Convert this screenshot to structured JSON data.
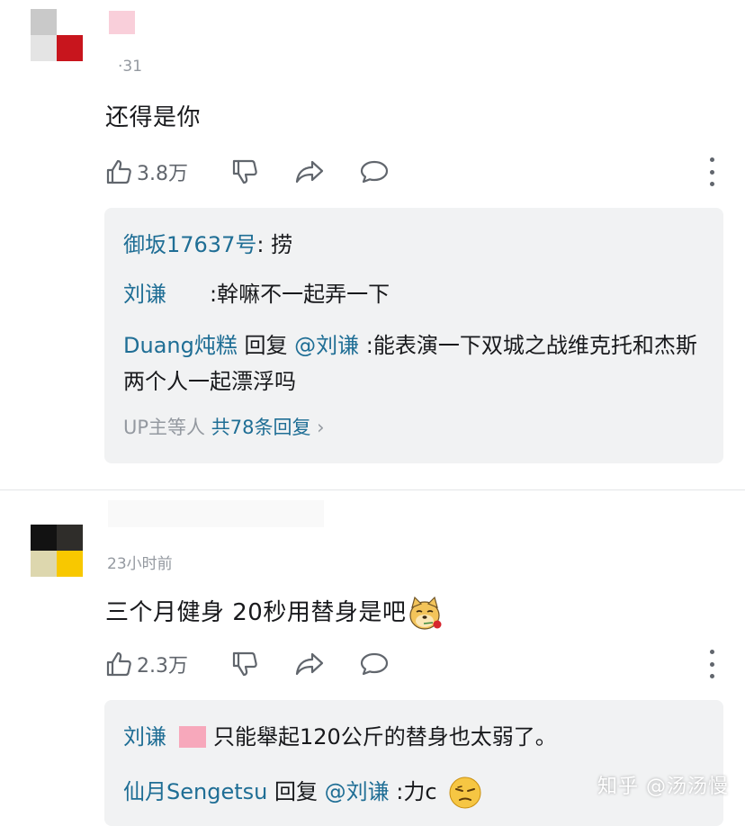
{
  "comments": [
    {
      "time": "·31",
      "content": "还得是你",
      "like_count": "3.8万",
      "replies": [
        {
          "user": "御坂17637号",
          "sep": ": ",
          "text": "捞"
        },
        {
          "user": "刘谦",
          "sep": ":",
          "text": "幹嘛不一起弄一下"
        },
        {
          "user": "Duang炖糕",
          "reply_word": " 回复 ",
          "at": "@刘谦",
          "sep": " :",
          "text": "能表演一下双城之战维克托和杰斯两个人一起漂浮吗"
        }
      ],
      "summary": {
        "prefix": "UP主等人 ",
        "total": "共78条回复",
        "chevron": "›"
      }
    },
    {
      "time": "23小时前",
      "content": "三个月健身 20秒用替身是吧",
      "like_count": "2.3万",
      "replies": [
        {
          "user": "刘谦",
          "sep": " ",
          "text": "只能舉起120公斤的替身也太弱了。"
        },
        {
          "user": "仙月Sengetsu",
          "reply_word": " 回复 ",
          "at": "@刘谦",
          "sep": " :",
          "text": "力c"
        }
      ]
    }
  ],
  "icons": {
    "like": "thumbs-up-icon",
    "dislike": "thumbs-down-icon",
    "share": "share-icon",
    "reply": "comment-icon",
    "more": "more-vertical-icon"
  },
  "colors": {
    "username": "#1f6e95",
    "muted": "#9499a0",
    "reply_bg": "#f1f2f3"
  },
  "watermark": "知乎 @汤汤慢"
}
